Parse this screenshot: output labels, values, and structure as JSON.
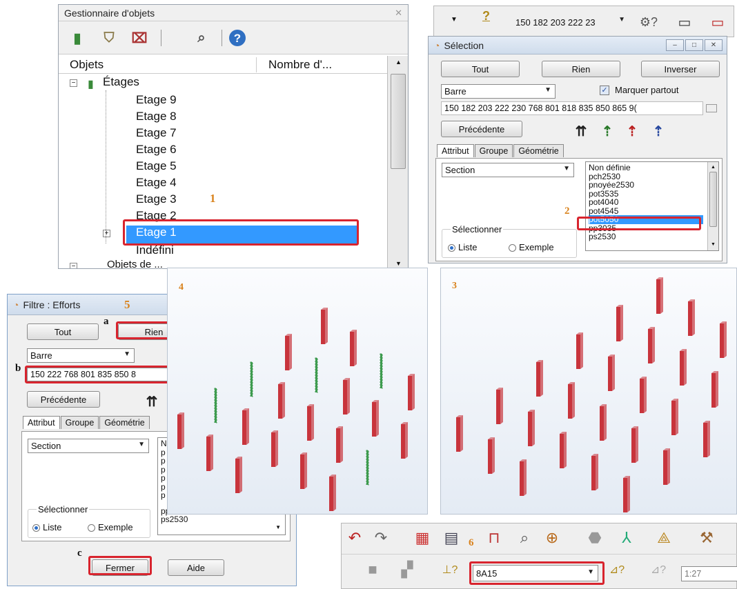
{
  "object_manager": {
    "title": "Gestionnaire d'objets",
    "col_objects": "Objets",
    "col_count": "Nombre d'...",
    "root": "Étages",
    "floors": [
      "Etage 9",
      "Etage 8",
      "Etage 7",
      "Etage 6",
      "Etage 5",
      "Etage 4",
      "Etage 3",
      "Etage 2",
      "Etage 1",
      "Indéfini"
    ],
    "selected_floor": "Etage 1",
    "cut_item": "Objets de ..."
  },
  "top_toolbar": {
    "selection_value": "150 182 203 222 23"
  },
  "selection_dialog": {
    "title": "Sélection",
    "btn_all": "Tout",
    "btn_none": "Rien",
    "btn_invert": "Inverser",
    "type": "Barre",
    "mark_everywhere": "Marquer partout",
    "selection_text": "150 182 203 222 230 768 801 818 835 850 865 9(",
    "btn_previous": "Précédente",
    "tabs": [
      "Attribut",
      "Groupe",
      "Géométrie"
    ],
    "attribute": "Section",
    "list_items": [
      "Non définie",
      "pch2530",
      "pnoyée2530",
      "pot3535",
      "pot4040",
      "pot4545",
      "pot5050",
      "pp3035",
      "ps2530"
    ],
    "selected_list_item": "pot5050",
    "select_label": "Sélectionner",
    "radio_list": "Liste",
    "radio_example": "Exemple"
  },
  "filter_dialog": {
    "title": "Filtre : Efforts",
    "btn_all": "Tout",
    "btn_none": "Rien",
    "type": "Barre",
    "selection_text": "150 222 768 801 835 850 8",
    "btn_previous": "Précédente",
    "tabs": [
      "Attribut",
      "Groupe",
      "Géométrie"
    ],
    "attribute": "Section",
    "list_stub": [
      "N",
      "p",
      "p",
      "p",
      "p",
      "p",
      "p"
    ],
    "list_items_visible": [
      "pp3035",
      "ps2530"
    ],
    "select_label": "Sélectionner",
    "radio_list": "Liste",
    "radio_example": "Exemple",
    "btn_close": "Fermer",
    "btn_help": "Aide"
  },
  "bottom_toolbar": {
    "case_value": "8A15",
    "zoom_value": "1:27"
  },
  "markers": {
    "m1": "1",
    "m2": "2",
    "m3": "3",
    "m4": "4",
    "m5": "5",
    "m6": "6",
    "a": "a",
    "b": "b",
    "c": "c"
  },
  "colors": {
    "highlight_red": "#d8242e",
    "marker_orange": "#d9821c",
    "selected_blue": "#3399ff",
    "column_red": "#c8343c",
    "column_green": "#3e9b4f"
  }
}
